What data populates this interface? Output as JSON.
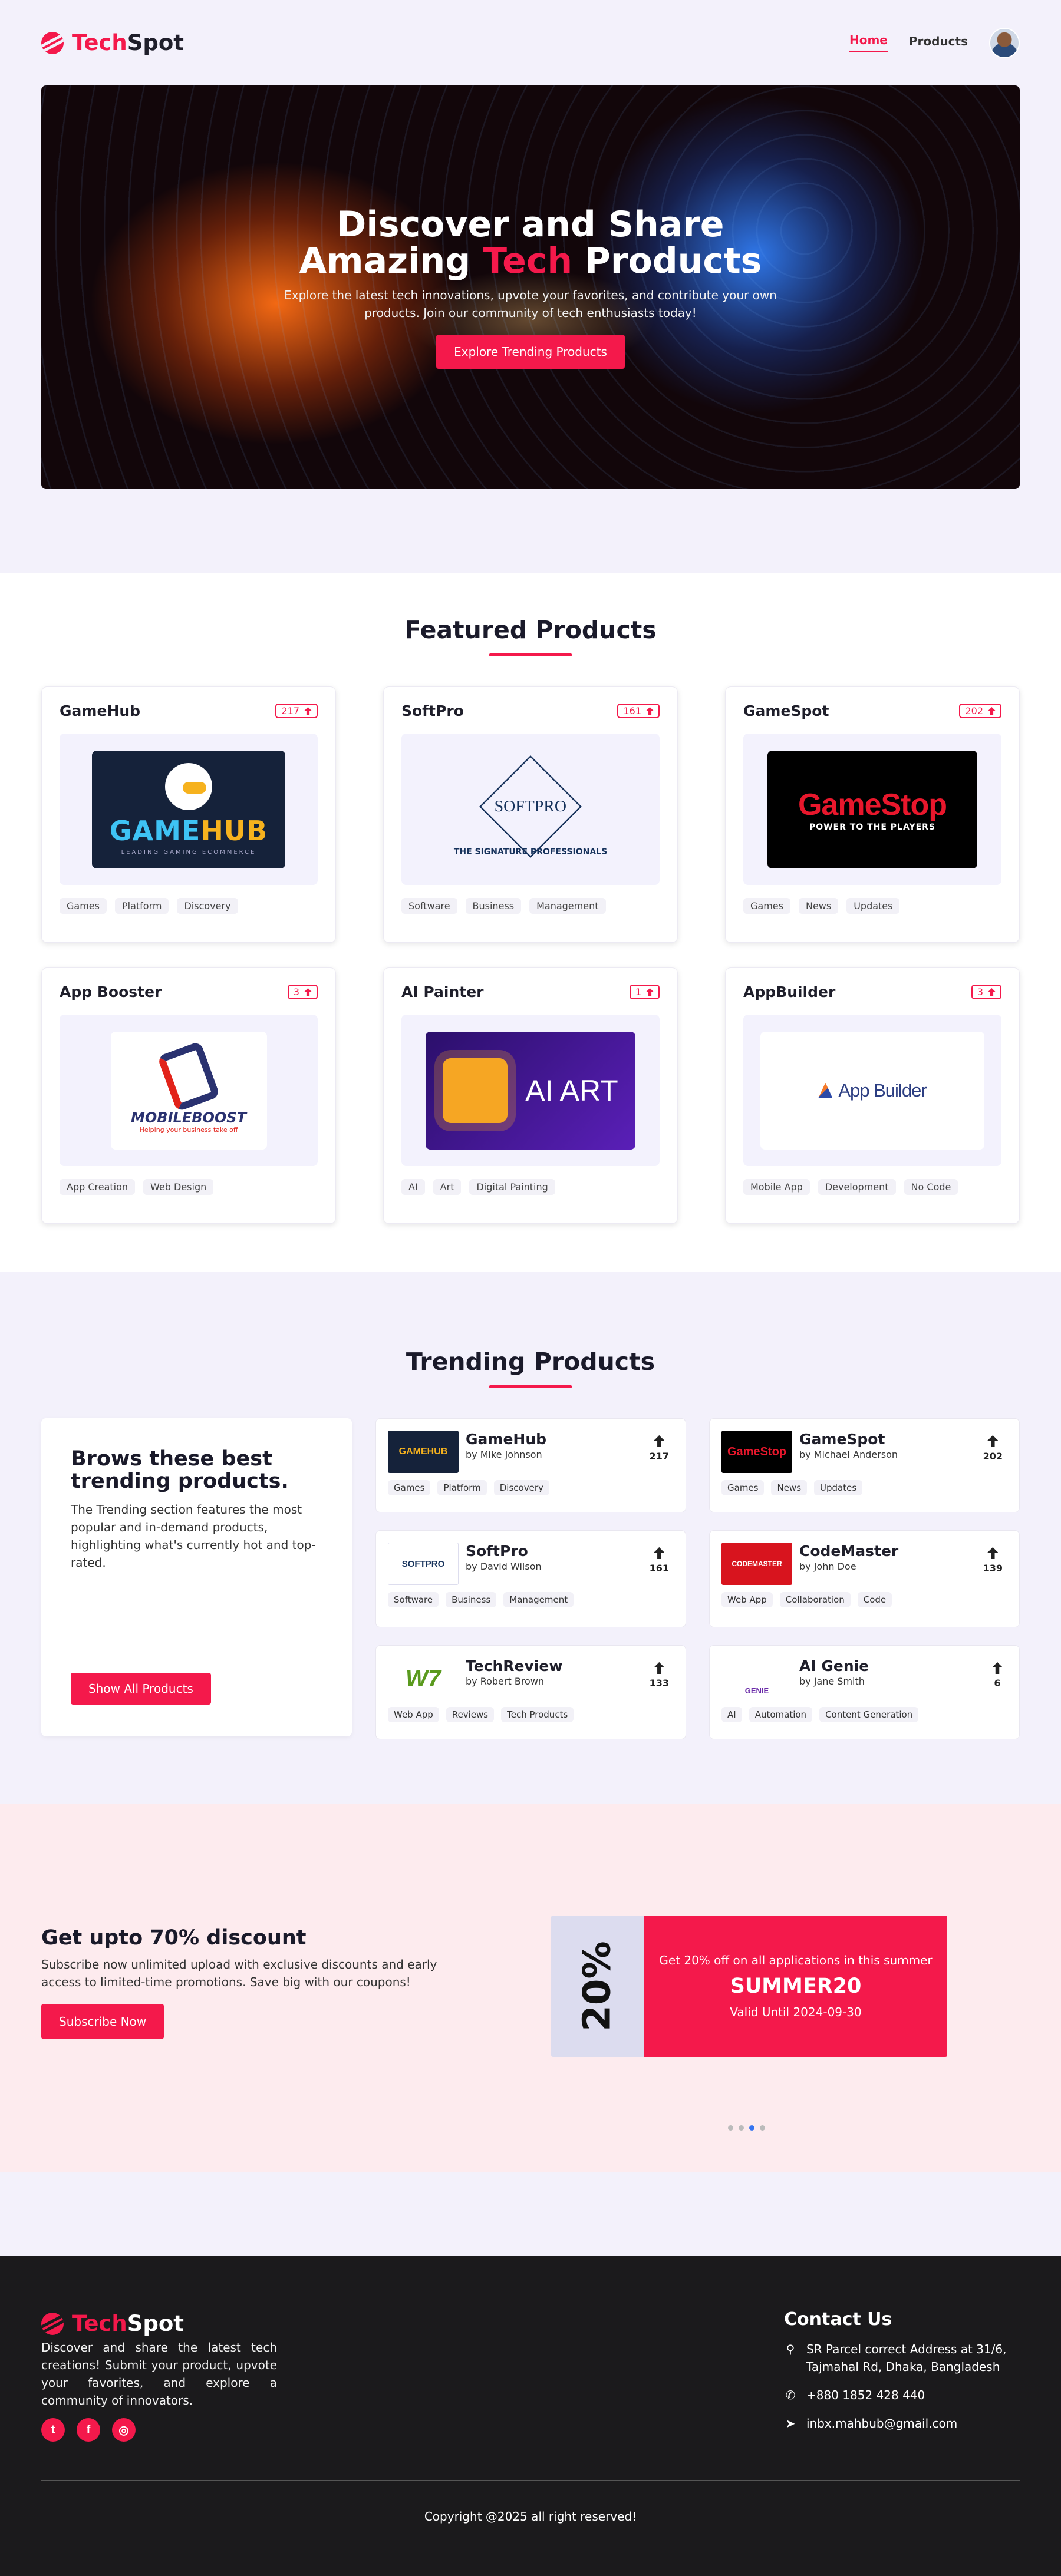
{
  "brand": {
    "name_a": "Tech",
    "name_b": "Spot"
  },
  "nav": {
    "home": "Home",
    "products": "Products"
  },
  "hero": {
    "title_line1": "Discover and Share",
    "title_pre": "Amazing ",
    "title_accent": "Tech",
    "title_post": " Products",
    "subtitle": "Explore the latest tech innovations, upvote your favorites, and contribute your own products. Join our community of tech enthusiasts today!",
    "cta": "Explore Trending Products"
  },
  "featured": {
    "title": "Featured Products",
    "products": [
      {
        "name": "GameHub",
        "votes": "217",
        "tags": [
          "Games",
          "Platform",
          "Discovery"
        ]
      },
      {
        "name": "SoftPro",
        "votes": "161",
        "tags": [
          "Software",
          "Business",
          "Management"
        ]
      },
      {
        "name": "GameSpot",
        "votes": "202",
        "tags": [
          "Games",
          "News",
          "Updates"
        ]
      },
      {
        "name": "App Booster",
        "votes": "3",
        "tags": [
          "App Creation",
          "Web Design"
        ]
      },
      {
        "name": "AI Painter",
        "votes": "1",
        "tags": [
          "AI",
          "Art",
          "Digital Painting"
        ]
      },
      {
        "name": "AppBuilder",
        "votes": "3",
        "tags": [
          "Mobile App",
          "Development",
          "No Code"
        ]
      }
    ],
    "logos": {
      "gamehub_a": "GAME",
      "gamehub_b": "HUB",
      "gamehub_sub": "LEADING GAMING ECOMMERCE",
      "softpro": "SOFTPRO",
      "softpro_sub": "THE SIGNATURE PROFESSIONALS",
      "gamespot_a": "Game",
      "gamespot_b": "Stop",
      "gamespot_sub": "POWER TO THE PLAYERS",
      "mobile": "MOBILEBOOST",
      "mobile_sub": "Helping your business take off",
      "aiart": "AI ART",
      "appbuilder": "App Builder"
    }
  },
  "trending": {
    "title": "Trending Products",
    "intro_title": "Brows these best trending products.",
    "intro_text": "The Trending section features the most popular and in-demand products, highlighting what's currently hot and top-rated.",
    "intro_button": "Show All Products",
    "items": [
      {
        "name": "GameHub",
        "by": "by Mike Johnson",
        "votes": "217",
        "tags": [
          "Games",
          "Platform",
          "Discovery"
        ]
      },
      {
        "name": "GameSpot",
        "by": "by Michael Anderson",
        "votes": "202",
        "tags": [
          "Games",
          "News",
          "Updates"
        ]
      },
      {
        "name": "SoftPro",
        "by": "by David Wilson",
        "votes": "161",
        "tags": [
          "Software",
          "Business",
          "Management"
        ]
      },
      {
        "name": "CodeMaster",
        "by": "by John Doe",
        "votes": "139",
        "tags": [
          "Web App",
          "Collaboration",
          "Code"
        ]
      },
      {
        "name": "TechReview",
        "by": "by Robert Brown",
        "votes": "133",
        "tags": [
          "Web App",
          "Reviews",
          "Tech Products"
        ]
      },
      {
        "name": "AI Genie",
        "by": "by Jane Smith",
        "votes": "6",
        "tags": [
          "AI",
          "Automation",
          "Content Generation"
        ]
      }
    ],
    "thumbs": {
      "gamehub": "GAMEHUB",
      "gamespot": "GameStop",
      "softpro": "SOFTPRO",
      "codemaster": "CODEMASTER",
      "techreview": "W7",
      "aigenie": "GENIE"
    }
  },
  "discount": {
    "title": "Get upto 70% discount",
    "text": "Subscribe now unlimited upload with exclusive discounts and early access to limited-time promotions. Save big with our coupons!",
    "button": "Subscribe Now",
    "coupon_percent": "20%",
    "coupon_line": "Get 20% off on all applications in this summer",
    "coupon_code": "SUMMER20",
    "coupon_valid": "Valid Until 2024-09-30"
  },
  "footer": {
    "description": "Discover and share the latest tech creations! Submit your product, upvote your favorites, and explore a community of innovators.",
    "contact_title": "Contact Us",
    "address": "SR Parcel correct Address at 31/6, Tajmahal Rd, Dhaka, Bangladesh",
    "phone": "+880 1852 428 440",
    "email": "inbx.mahbub@gmail.com",
    "copyright": "Copyright @2025 all right reserved!"
  },
  "colors": {
    "accent": "#f4194b",
    "page_bg": "#f3f1fb",
    "footer_bg": "#1b1a1c",
    "discount_bg": "#fdebee"
  },
  "icons": [
    "twitter-icon",
    "facebook-icon",
    "instagram-icon",
    "location-icon",
    "phone-icon",
    "send-icon",
    "upvote-icon"
  ]
}
